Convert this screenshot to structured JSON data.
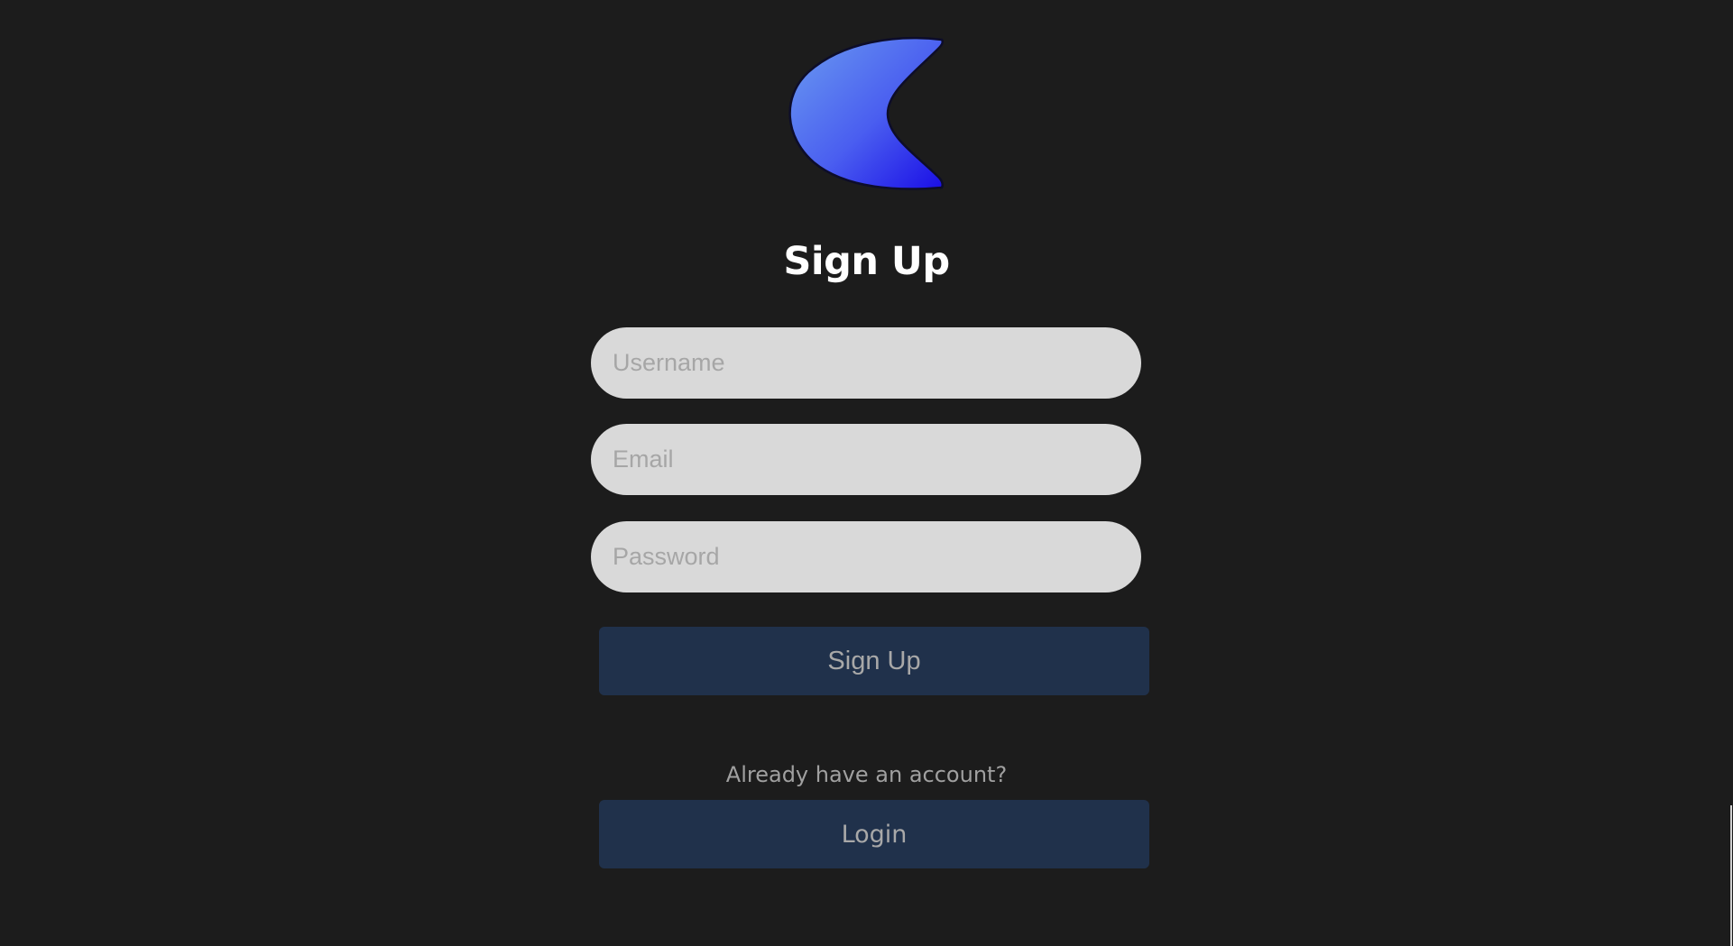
{
  "app": {
    "logo_icon": "crescent-moon-logo",
    "colors": {
      "background": "#1c1c1c",
      "logo_gradient_start": "#5a8cf0",
      "logo_gradient_end": "#1a0ee6",
      "input_background": "#d9d9d9",
      "button_background": "#20314b",
      "title": "#ffffff",
      "muted_text": "#a0a0a0"
    }
  },
  "form": {
    "title": "Sign Up",
    "username": {
      "placeholder": "Username",
      "value": ""
    },
    "email": {
      "placeholder": "Email",
      "value": ""
    },
    "password": {
      "placeholder": "Password",
      "value": ""
    },
    "submit_label": "Sign Up"
  },
  "footer": {
    "prompt": "Already have an account?",
    "login_label": "Login"
  }
}
